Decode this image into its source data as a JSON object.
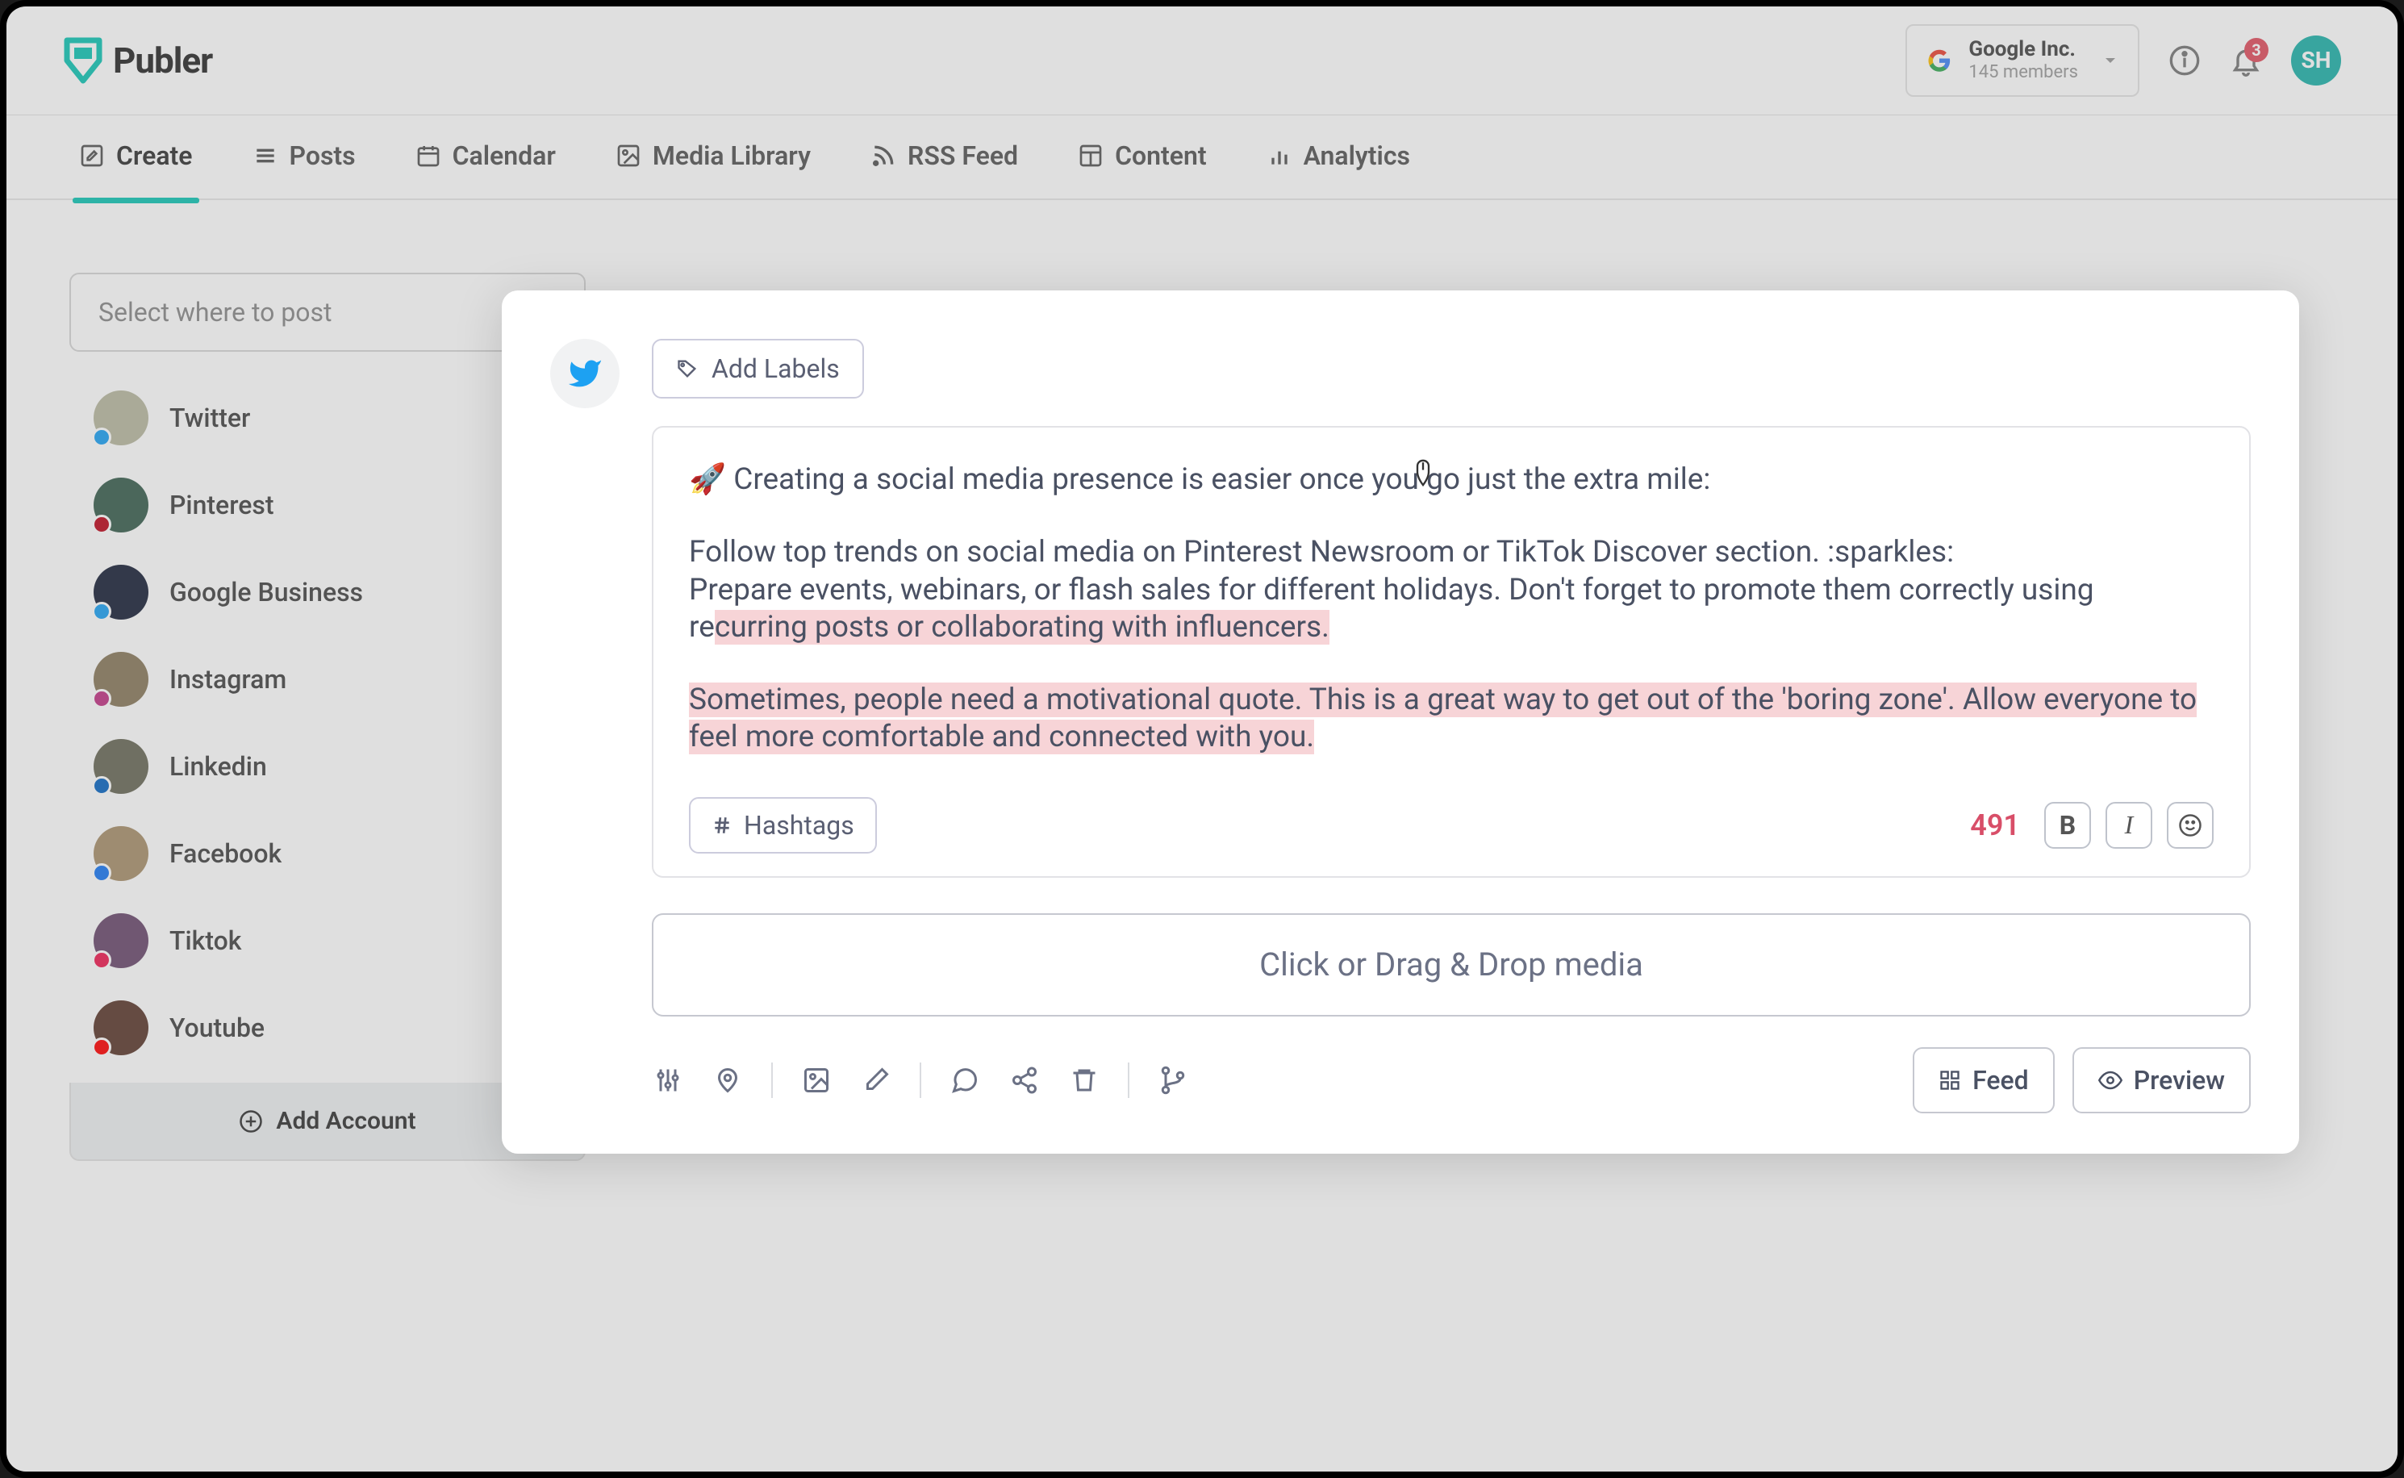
{
  "brand": {
    "name": "Publer"
  },
  "topbar": {
    "workspace": {
      "name": "Google Inc.",
      "subtitle": "145 members"
    },
    "notification_count": "3",
    "avatar_initials": "SH"
  },
  "nav": {
    "items": [
      {
        "label": "Create",
        "icon": "edit-square-icon",
        "active": true
      },
      {
        "label": "Posts",
        "icon": "list-icon"
      },
      {
        "label": "Calendar",
        "icon": "calendar-icon"
      },
      {
        "label": "Media Library",
        "icon": "image-icon"
      },
      {
        "label": "RSS Feed",
        "icon": "rss-icon"
      },
      {
        "label": "Content",
        "icon": "layout-icon"
      },
      {
        "label": "Analytics",
        "icon": "bar-chart-icon"
      }
    ]
  },
  "sidebar": {
    "select_placeholder": "Select where to post",
    "accounts": [
      {
        "label": "Twitter",
        "dot": "#1da1f2",
        "avatar_bg": "#b8b8a0"
      },
      {
        "label": "Pinterest",
        "dot": "#bd081c",
        "avatar_bg": "#3a5f4f"
      },
      {
        "label": "Google Business",
        "dot": "#1da1f2",
        "avatar_bg": "#1a2238"
      },
      {
        "label": "Instagram",
        "dot": "#c13584",
        "avatar_bg": "#8a7a5c"
      },
      {
        "label": "Linkedin",
        "dot": "#0a66c2",
        "avatar_bg": "#6a6a58"
      },
      {
        "label": "Facebook",
        "dot": "#1877f2",
        "avatar_bg": "#a8906c"
      },
      {
        "label": "Tiktok",
        "dot": "#ee1d52",
        "avatar_bg": "#6b4a6e"
      },
      {
        "label": "Youtube",
        "dot": "#ff0000",
        "avatar_bg": "#5c3a2e"
      }
    ],
    "add_account_label": "Add Account"
  },
  "composer": {
    "add_labels_label": "Add Labels",
    "text_lines": {
      "line1_prefix": "🚀 ",
      "line1": "Creating a social media presence is easier once you go just the extra mile:",
      "line2": "Follow top trends on social media on Pinterest Newsroom or TikTok Discover section. :sparkles:",
      "line3_plain": "Prepare events, webinars, or flash sales for different holidays. Don't forget to promote them correctly using re",
      "line3_hl": "curring posts or collaborating with influencers.",
      "line4_hl": "Sometimes, people need a motivational quote. This is a great way to get out of the 'boring zone'. Allow everyone to feel more comfortable and connected with you."
    },
    "hashtags_label": "Hashtags",
    "char_count": "491",
    "dropzone_text": "Click or Drag & Drop media",
    "feed_label": "Feed",
    "preview_label": "Preview"
  },
  "colors": {
    "accent": "#12c4b5",
    "danger": "#d84e68"
  }
}
